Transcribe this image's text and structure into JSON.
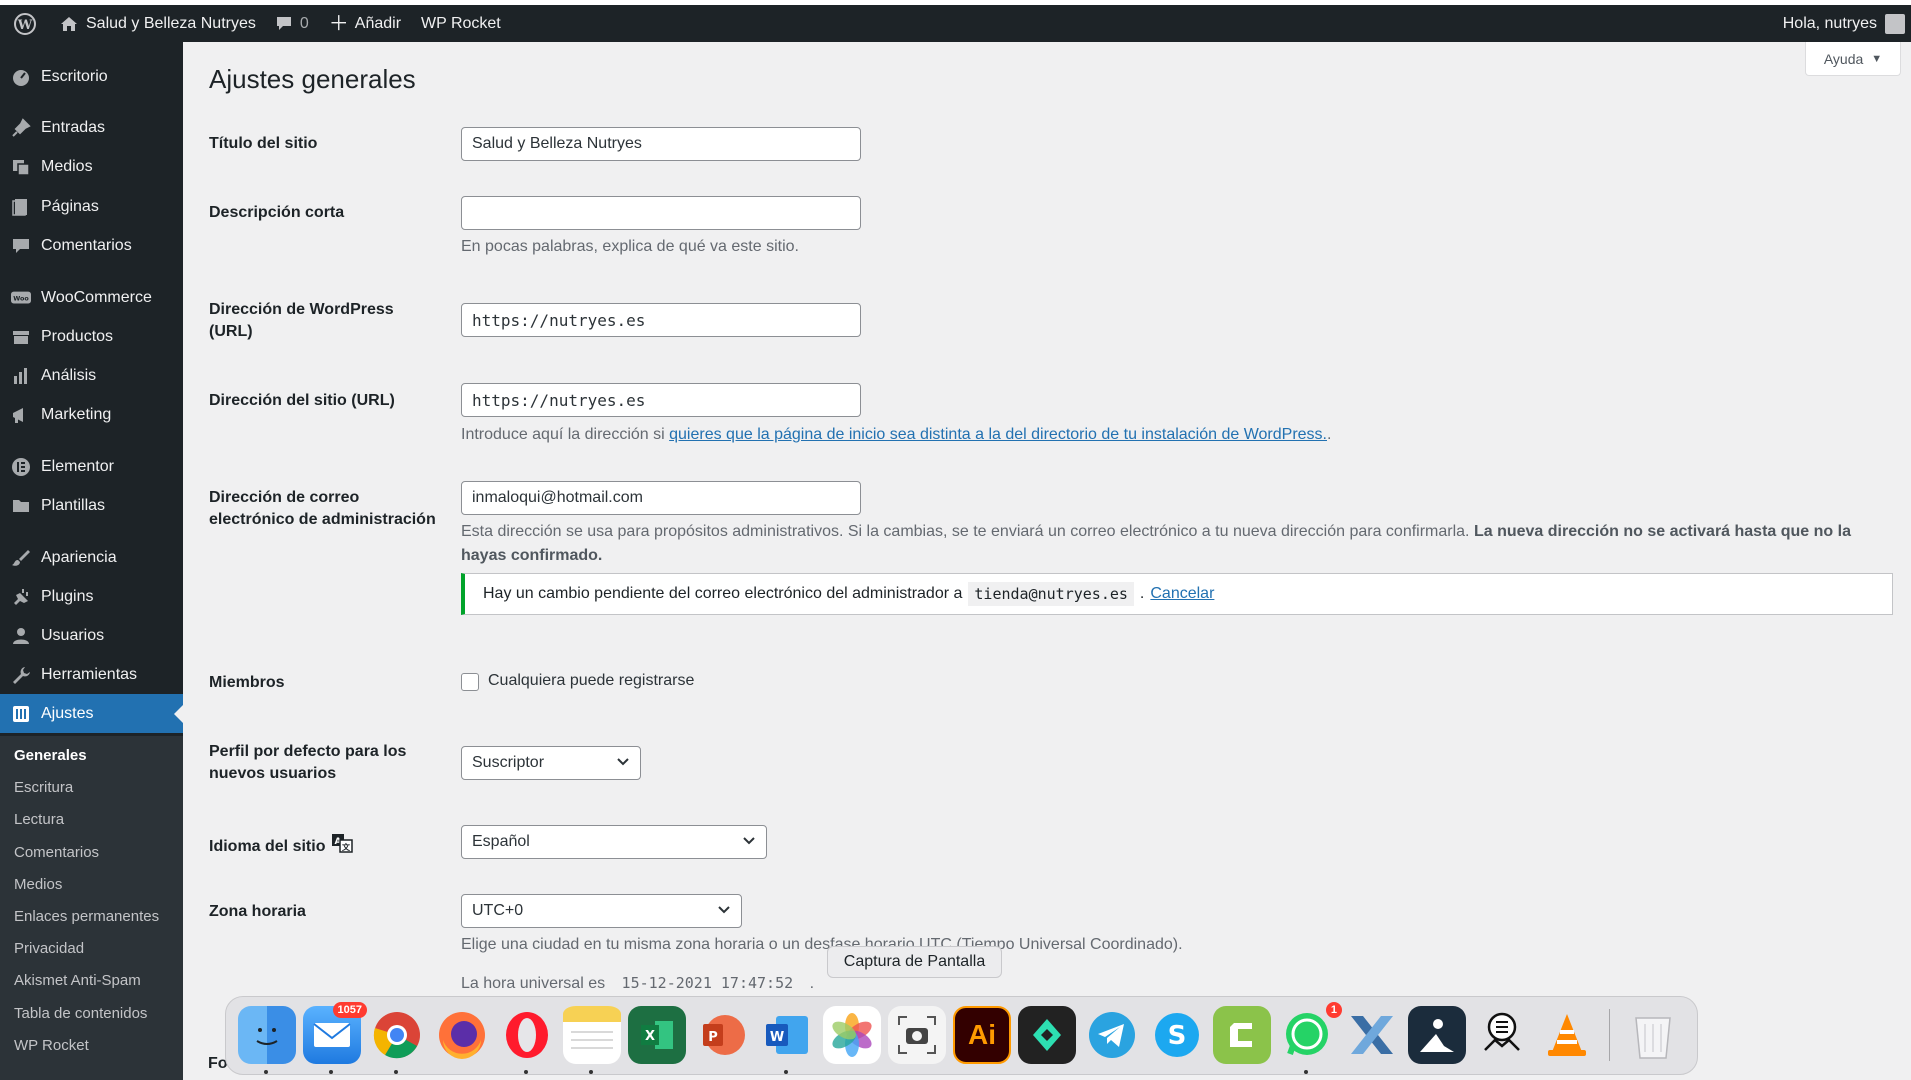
{
  "admin_bar": {
    "site_name": "Salud y Belleza Nutryes",
    "comments_count": "0",
    "new_label": "Añadir",
    "wp_rocket": "WP Rocket",
    "greeting": "Hola, nutryes"
  },
  "sidebar": {
    "items": [
      {
        "label": "Escritorio",
        "icon": "dashboard-icon"
      },
      {
        "label": "Entradas",
        "icon": "pin-icon"
      },
      {
        "label": "Medios",
        "icon": "media-icon"
      },
      {
        "label": "Páginas",
        "icon": "pages-icon"
      },
      {
        "label": "Comentarios",
        "icon": "comment-icon"
      },
      {
        "label": "WooCommerce",
        "icon": "woo-icon"
      },
      {
        "label": "Productos",
        "icon": "products-icon"
      },
      {
        "label": "Análisis",
        "icon": "chart-icon"
      },
      {
        "label": "Marketing",
        "icon": "megaphone-icon"
      },
      {
        "label": "Elementor",
        "icon": "elementor-icon"
      },
      {
        "label": "Plantillas",
        "icon": "folder-icon"
      },
      {
        "label": "Apariencia",
        "icon": "brush-icon"
      },
      {
        "label": "Plugins",
        "icon": "plug-icon"
      },
      {
        "label": "Usuarios",
        "icon": "user-icon"
      },
      {
        "label": "Herramientas",
        "icon": "wrench-icon"
      },
      {
        "label": "Ajustes",
        "icon": "settings-icon"
      }
    ],
    "submenu": [
      "Generales",
      "Escritura",
      "Lectura",
      "Comentarios",
      "Medios",
      "Enlaces permanentes",
      "Privacidad",
      "Akismet Anti-Spam",
      "Tabla de contenidos",
      "WP Rocket"
    ]
  },
  "page": {
    "help": "Ayuda",
    "title": "Ajustes generales"
  },
  "form": {
    "site_title_label": "Título del sitio",
    "site_title_value": "Salud y Belleza Nutryes",
    "tagline_label": "Descripción corta",
    "tagline_value": "",
    "tagline_desc": "En pocas palabras, explica de qué va este sitio.",
    "wp_url_label_1": "Dirección de WordPress",
    "wp_url_label_2": "(URL)",
    "wp_url_value": "https://nutryes.es",
    "site_url_label": "Dirección del sitio (URL)",
    "site_url_value": "https://nutryes.es",
    "site_url_desc_pre": "Introduce aquí la dirección si ",
    "site_url_desc_link": "quieres que la página de inicio sea distinta a la del directorio de tu instalación de WordPress.",
    "site_url_desc_post": ".",
    "email_label_1": "Dirección de correo",
    "email_label_2": "electrónico de administración",
    "email_value": "inmaloqui@hotmail.com",
    "email_desc_line1": "Esta dirección se usa para propósitos administrativos. Si la cambias, se te enviará un correo electrónico a tu nueva dirección para confirmarla. ",
    "email_desc_bold_1": "La nueva dirección no se activará hasta que no la",
    "email_desc_bold_2": "hayas confirmado.",
    "notice_pre": "Hay un cambio pendiente del correo electrónico del administrador a",
    "notice_email": "tienda@nutryes.es",
    "notice_mid": ".",
    "notice_cancel": "Cancelar",
    "members_label": "Miembros",
    "members_checkbox": "Cualquiera puede registrarse",
    "members_checked": false,
    "role_label_1": "Perfil por defecto para los",
    "role_label_2": "nuevos usuarios",
    "role_value": "Suscriptor",
    "lang_label": "Idioma del sitio",
    "lang_value": "Español",
    "tz_label": "Zona horaria",
    "tz_value": "UTC+0",
    "tz_desc": "Elige una ciudad en tu misma zona horaria o un desfase horario UTC (Tiempo Universal Coordinado).",
    "utc_label": "La hora universal es",
    "utc_value": "15-12-2021 17:47:52",
    "utc_post": ".",
    "next_label_partial": "Fo"
  },
  "dock": {
    "tooltip": "Captura de Pantalla",
    "mail_badge": "1057",
    "whatsapp_badge": "1",
    "illustrator_label": "Ai"
  },
  "colors": {
    "admin_bar": "#1d2327",
    "accent": "#2271b1",
    "notice_border": "#00a32a"
  }
}
